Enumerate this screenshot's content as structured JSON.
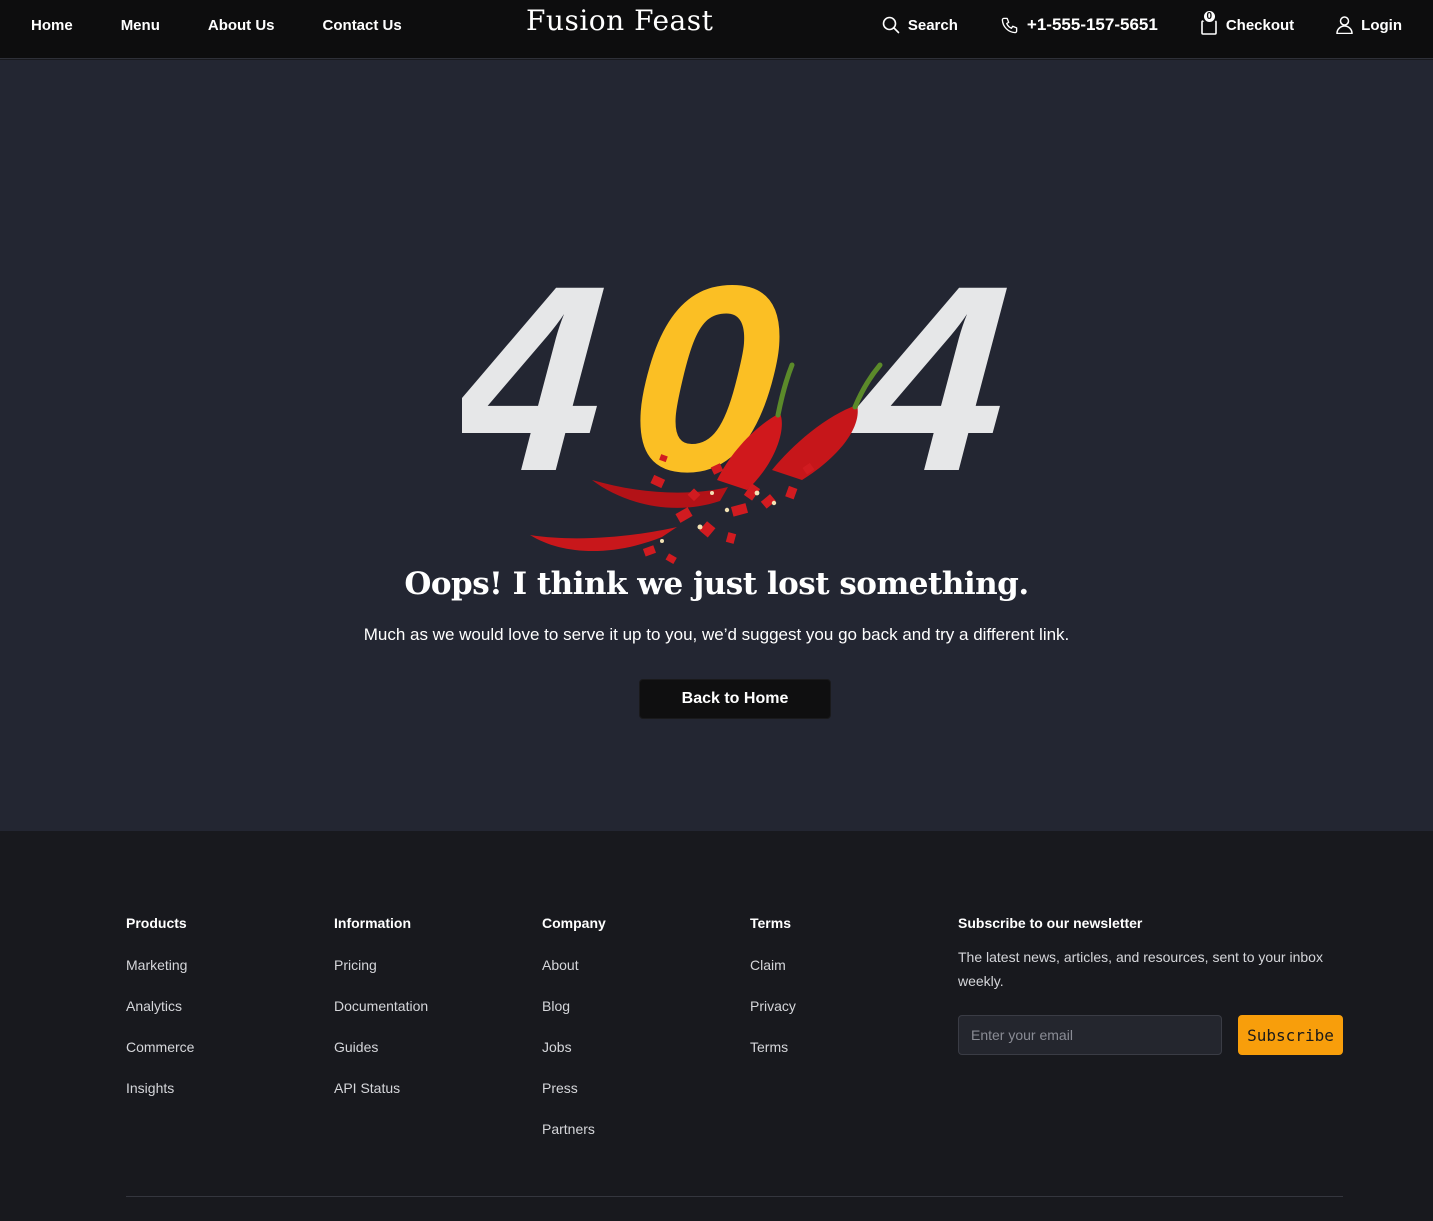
{
  "header": {
    "nav": [
      "Home",
      "Menu",
      "About Us",
      "Contact Us"
    ],
    "logo": "Fusion Feast",
    "search_label": "Search",
    "phone": "+1-555-157-5651",
    "cart_count": "0",
    "checkout_label": "Checkout",
    "login_label": "Login"
  },
  "hero": {
    "code_digits": [
      "4",
      "0",
      "4"
    ],
    "title": "Oops! I think we just lost something.",
    "subtitle": "Much as we would love to serve it up to you, we’d suggest you go back and try a different link.",
    "back_button": "Back to Home",
    "colors": {
      "digit_light": "#e6e7e8",
      "digit_accent": "#fbbf24",
      "chili": "#c8171b",
      "background": "#232632"
    }
  },
  "footer": {
    "columns": [
      {
        "title": "Products",
        "items": [
          "Marketing",
          "Analytics",
          "Commerce",
          "Insights"
        ]
      },
      {
        "title": "Information",
        "items": [
          "Pricing",
          "Documentation",
          "Guides",
          "API Status"
        ]
      },
      {
        "title": "Company",
        "items": [
          "About",
          "Blog",
          "Jobs",
          "Press",
          "Partners"
        ]
      },
      {
        "title": "Terms",
        "items": [
          "Claim",
          "Privacy",
          "Terms"
        ]
      }
    ],
    "newsletter": {
      "title": "Subscribe to our newsletter",
      "description": "The latest news, articles, and resources, sent to your inbox weekly.",
      "email_placeholder": "Enter your email",
      "email_value": "",
      "subscribe_label": "Subscribe"
    },
    "accent_color": "#f89e0b"
  }
}
